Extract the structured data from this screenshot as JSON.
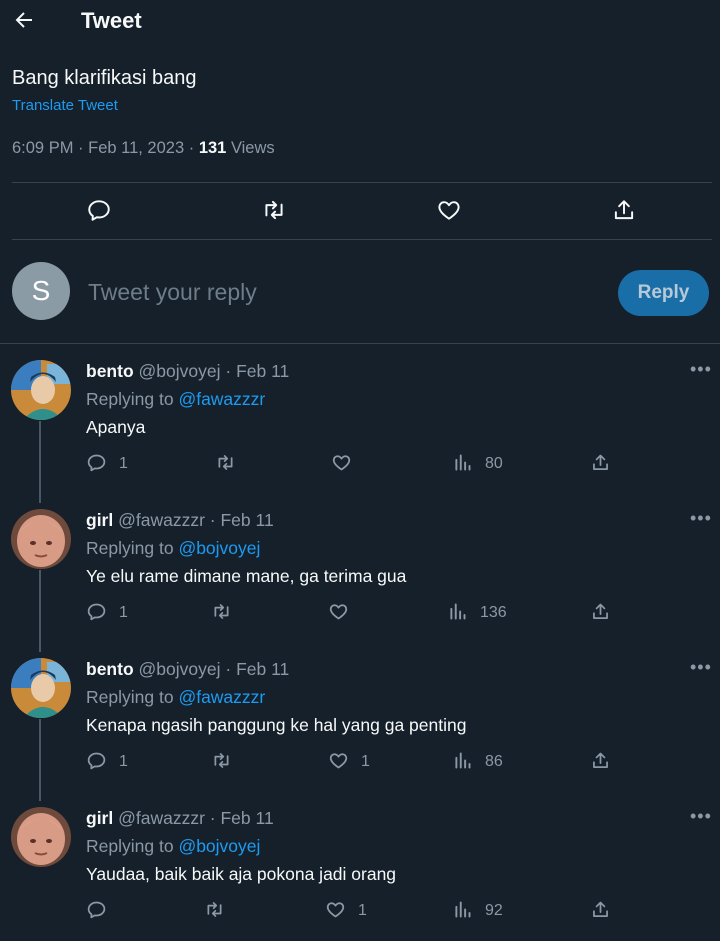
{
  "header": {
    "title": "Tweet"
  },
  "tweet": {
    "text": "Bang klarifikasi bang",
    "translate": "Translate Tweet",
    "time": "6:09 PM · Feb 11, 2023 ·",
    "views_count": "131",
    "views_label": "Views"
  },
  "compose": {
    "avatar_letter": "S",
    "placeholder": "Tweet your reply",
    "button": "Reply"
  },
  "replies": [
    {
      "name": "bento",
      "handle": "@bojvoyej",
      "date": "· Feb 11",
      "replying_prefix": "Replying to",
      "replying_to": "@fawazzzr",
      "text": "Apanya",
      "replies": "1",
      "retweets": "",
      "likes": "",
      "views": "80"
    },
    {
      "name": "girl",
      "handle": "@fawazzzr",
      "date": "· Feb 11",
      "replying_prefix": "Replying to",
      "replying_to": "@bojvoyej",
      "text": "Ye elu rame dimane mane, ga terima gua",
      "replies": "1",
      "retweets": "",
      "likes": "",
      "views": "136"
    },
    {
      "name": "bento",
      "handle": "@bojvoyej",
      "date": "· Feb 11",
      "replying_prefix": "Replying to",
      "replying_to": "@fawazzzr",
      "text": "Kenapa ngasih panggung ke hal yang ga penting",
      "replies": "1",
      "retweets": "",
      "likes": "1",
      "views": "86"
    },
    {
      "name": "girl",
      "handle": "@fawazzzr",
      "date": "· Feb 11",
      "replying_prefix": "Replying to",
      "replying_to": "@bojvoyej",
      "text": "Yaudaa, baik baik aja pokona jadi orang",
      "replies": "",
      "retweets": "",
      "likes": "1",
      "views": "92"
    }
  ],
  "colors": {
    "background": "#15202b",
    "link": "#1d9bf0",
    "muted": "#8b98a5",
    "reply_button": "#1a6ea7"
  }
}
